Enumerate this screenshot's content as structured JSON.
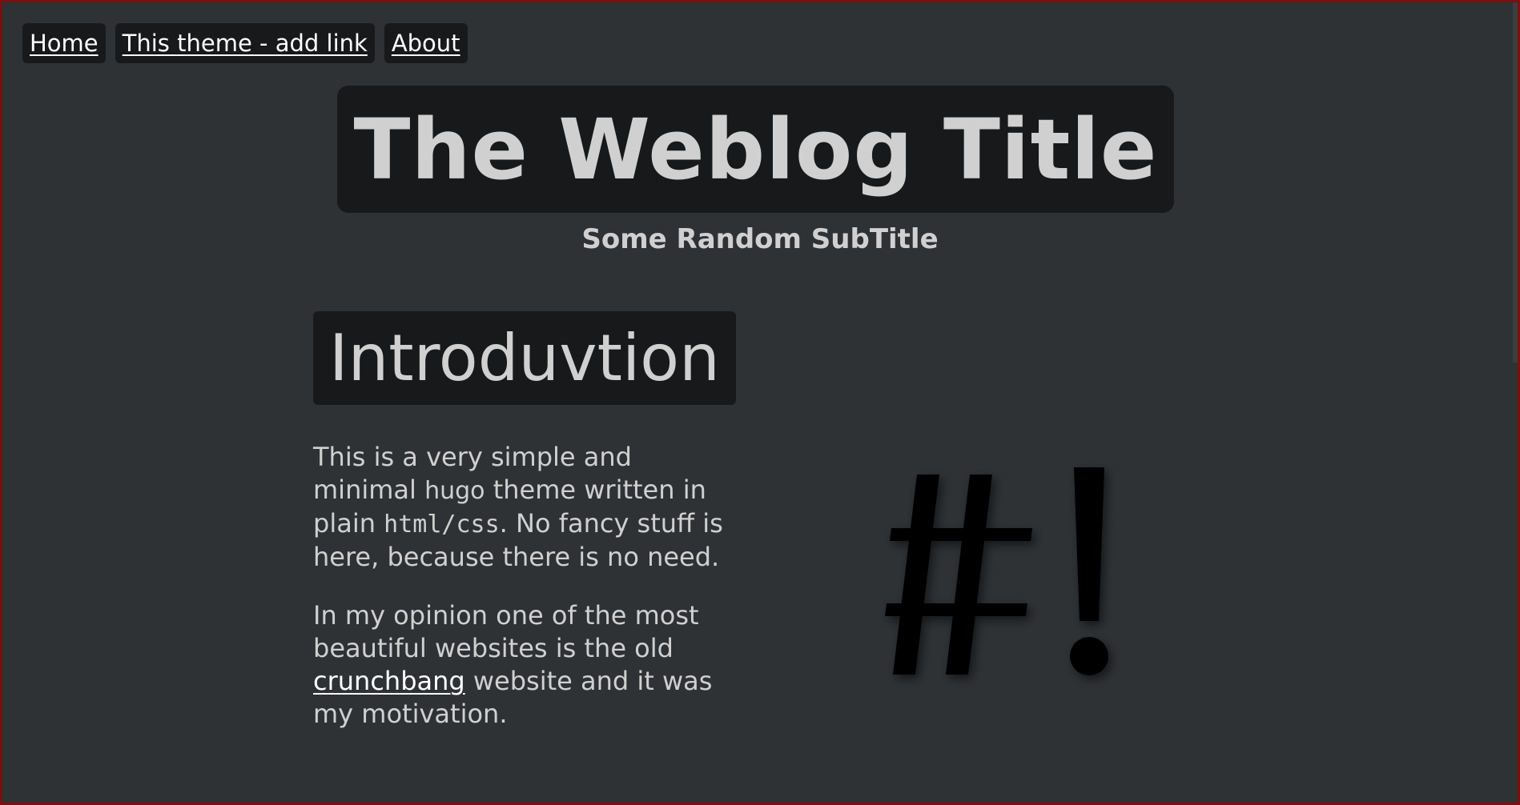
{
  "nav": {
    "items": [
      {
        "label": "Home"
      },
      {
        "label": "This theme - add link"
      },
      {
        "label": "About"
      }
    ]
  },
  "header": {
    "title": "The Weblog Title",
    "subtitle": "Some Random SubTitle"
  },
  "main": {
    "heading": "Introduvtion",
    "paragraph1": {
      "part1": "This is a very simple and minimal ",
      "hugo": "hugo",
      "part2": " theme written in plain ",
      "code": "html/css",
      "part3": ". No fancy stuff is here, because there is no need."
    },
    "paragraph2": {
      "part1": "In my opinion one of the most beautiful websites is the old ",
      "link": "crunchbang",
      "part2": " website and it was my motivation."
    }
  },
  "logo": {
    "text": "#!",
    "icon": "crunchbang-logo-icon"
  },
  "colors": {
    "background": "#2e3235",
    "panel": "#17191a",
    "text": "#d0d0d0",
    "link": "#ffffff",
    "border": "#7a1010"
  }
}
